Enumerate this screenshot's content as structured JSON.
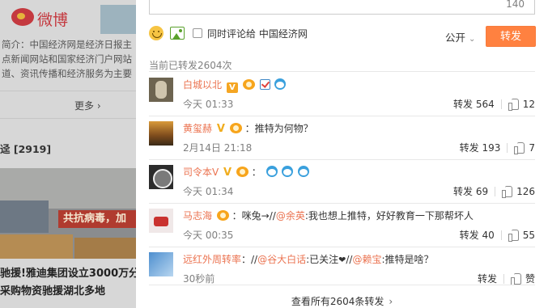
{
  "background": {
    "brand": "微博",
    "intro_lines": [
      "简介：中国经济网是经济日报主",
      "点新闻网站和国家经济门户网站",
      "道、资讯传播和经济服务为主要"
    ],
    "more_label": "更多",
    "repost_count_label": "迳 [2919]",
    "photo_banner": "共抗病毒，加",
    "headline_lines": [
      "驰援!雅迪集团设立3000万分",
      "采购物资驰援湖北多地"
    ]
  },
  "composer": {
    "char_counter": "140",
    "checkbox_label": "同时评论给 中国经济网",
    "visibility": "公开",
    "submit_label": "转发"
  },
  "reposts": {
    "title": "当前已转发2604次",
    "items": [
      {
        "name": "白城以北",
        "content": "",
        "time": "今天 01:33",
        "repost_label": "转发",
        "repost_count": "564",
        "like_count": "12"
      },
      {
        "name": "黄玺赫",
        "content": "：推特为何物？",
        "time": "2月14日 21:18",
        "repost_label": "转发",
        "repost_count": "193",
        "like_count": "7"
      },
      {
        "name": "司令本V",
        "content": "",
        "time": "今天 01:34",
        "repost_label": "转发",
        "repost_count": "69",
        "like_count": "126"
      },
      {
        "name": "马志海",
        "content_pre": "：咪兔→//",
        "mention": "@余英",
        "content_post": ":我也想上推特，好好教育一下那帮坏人",
        "time": "今天 00:35",
        "repost_label": "转发",
        "repost_count": "40",
        "like_count": "55"
      },
      {
        "name": "远红外周转率",
        "content_pre": "：//",
        "mention": "@谷大白话",
        "content_mid": ":已关注",
        "heart": "❤",
        "content_mid2": "//",
        "mention2": "@赖宝",
        "content_post": ":推特是啥？",
        "time": "30秒前",
        "repost_label": "转发",
        "repost_count": "",
        "like_count": "赞"
      }
    ],
    "footer": "查看所有2604条转发"
  }
}
